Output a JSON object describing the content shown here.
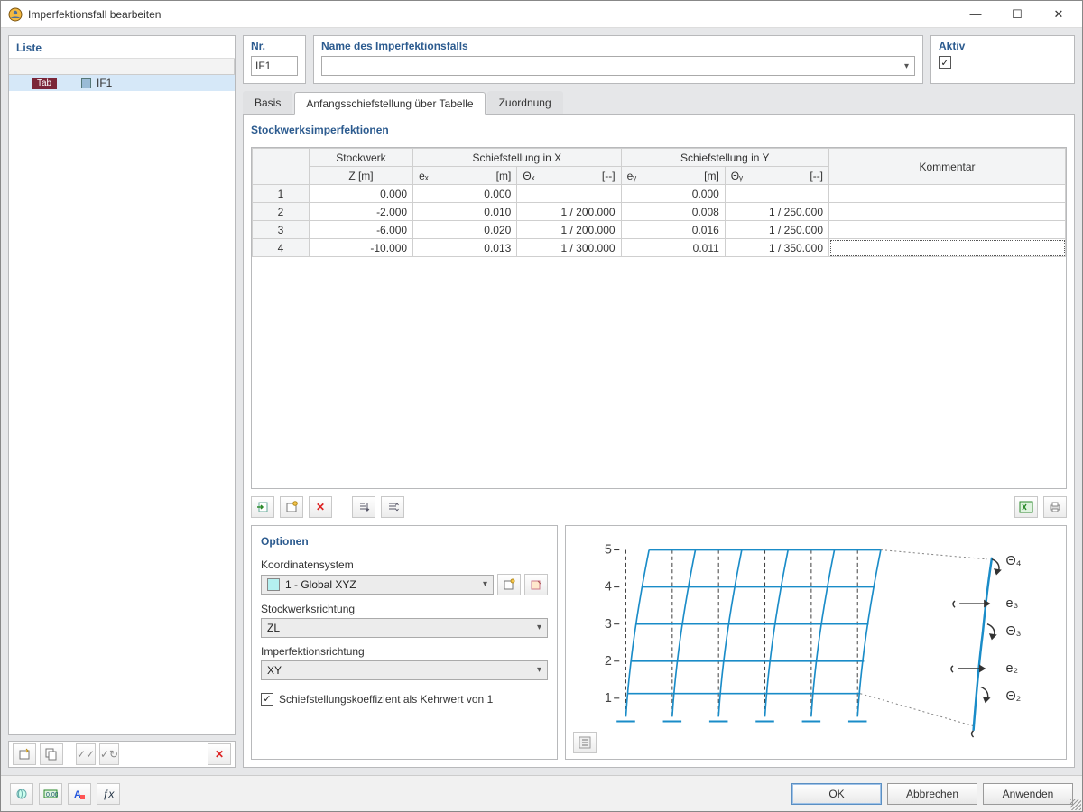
{
  "window": {
    "title": "Imperfektionsfall bearbeiten"
  },
  "left": {
    "header": "Liste",
    "tabchip": "Tab",
    "item": "IF1"
  },
  "topfields": {
    "nr_label": "Nr.",
    "nr_value": "IF1",
    "name_label": "Name des Imperfektionsfalls",
    "name_value": "",
    "aktiv_label": "Aktiv"
  },
  "tabs": {
    "basis": "Basis",
    "table": "Anfangsschiefstellung über Tabelle",
    "zuord": "Zuordnung"
  },
  "section_header": "Stockwerksimperfektionen",
  "columns": {
    "stockwerk_top": "Stockwerk",
    "stockwerk_sub": "Z [m]",
    "schief_x": "Schiefstellung in X",
    "schief_y": "Schiefstellung in Y",
    "ex": "eₓ",
    "ex_u": "[m]",
    "thetax": "Θₓ",
    "thetax_u": "[--]",
    "ey": "eᵧ",
    "ey_u": "[m]",
    "thetay": "Θᵧ",
    "thetay_u": "[--]",
    "kommentar": "Kommentar"
  },
  "rows": [
    {
      "n": "1",
      "z": "0.000",
      "ex": "0.000",
      "tx": "",
      "ey": "0.000",
      "ty": "",
      "k": ""
    },
    {
      "n": "2",
      "z": "-2.000",
      "ex": "0.010",
      "tx": "1 / 200.000",
      "ey": "0.008",
      "ty": "1 / 250.000",
      "k": ""
    },
    {
      "n": "3",
      "z": "-6.000",
      "ex": "0.020",
      "tx": "1 / 200.000",
      "ey": "0.016",
      "ty": "1 / 250.000",
      "k": ""
    },
    {
      "n": "4",
      "z": "-10.000",
      "ex": "0.013",
      "tx": "1 / 300.000",
      "ey": "0.011",
      "ty": "1 / 350.000",
      "k": ""
    }
  ],
  "options": {
    "header": "Optionen",
    "coord_label": "Koordinatensystem",
    "coord_value": "1 - Global XYZ",
    "storey_dir_label": "Stockwerksrichtung",
    "storey_dir_value": "ZL",
    "imp_dir_label": "Imperfektionsrichtung",
    "imp_dir_value": "XY",
    "reciprocal": "Schiefstellungskoeffizient als Kehrwert von 1"
  },
  "diagram": {
    "y_ticks": [
      "5",
      "4",
      "3",
      "2",
      "1"
    ],
    "labels": [
      "Θ₄",
      "e₃",
      "Θ₃",
      "e₂",
      "Θ₂"
    ]
  },
  "buttons": {
    "ok": "OK",
    "cancel": "Abbrechen",
    "apply": "Anwenden"
  },
  "chart_data": {
    "type": "table",
    "columns": [
      "Stockwerk Z [m]",
      "eX [m]",
      "ΘX [--]",
      "eY [m]",
      "ΘY [--]"
    ],
    "rows": [
      [
        0.0,
        0.0,
        null,
        0.0,
        null
      ],
      [
        -2.0,
        0.01,
        "1/200.000",
        0.008,
        "1/250.000"
      ],
      [
        -6.0,
        0.02,
        "1/200.000",
        0.016,
        "1/250.000"
      ],
      [
        -10.0,
        0.013,
        "1/300.000",
        0.011,
        "1/350.000"
      ]
    ]
  }
}
